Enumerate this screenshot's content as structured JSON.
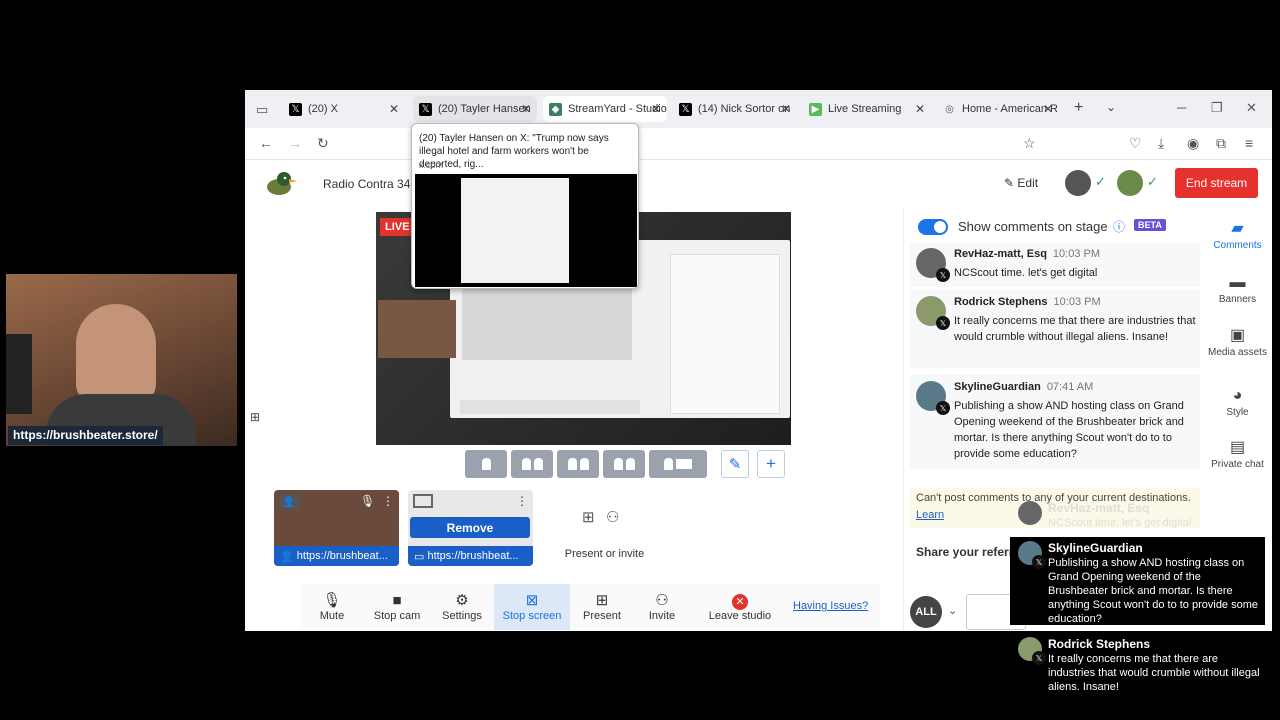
{
  "browser": {
    "tabs": [
      {
        "title": "(20) X",
        "icon": "x-logo-icon"
      },
      {
        "title": "(20) Tayler Hansen",
        "icon": "x-logo-icon"
      },
      {
        "title": "StreamYard - Studio",
        "icon": "streamyard-icon"
      },
      {
        "title": "(14) Nick Sortor on",
        "icon": "x-logo-icon"
      },
      {
        "title": "Live Streaming",
        "icon": "play-icon"
      },
      {
        "title": "Home - American R",
        "icon": "globe-icon"
      }
    ],
    "tab_preview": {
      "title": "(20) Tayler Hansen on X: \"Trump now says illegal hotel and farm workers won't be deported, rig...",
      "domain": "x.com"
    }
  },
  "studio": {
    "broadcast_name": "Radio Contra 34",
    "edit_label": "Edit",
    "end_stream_label": "End stream",
    "live_badge": "LIVE",
    "cards": [
      {
        "label": "https://brushbeat..."
      },
      {
        "label": "https://brushbeat..."
      }
    ],
    "remove_label": "Remove",
    "present_invite_label": "Present or invite",
    "toolbar": [
      {
        "label": "Mute",
        "icon": "mic-icon"
      },
      {
        "label": "Stop cam",
        "icon": "camera-icon"
      },
      {
        "label": "Settings",
        "icon": "gear-icon"
      },
      {
        "label": "Stop screen",
        "icon": "screen-share-icon"
      },
      {
        "label": "Present",
        "icon": "present-icon"
      },
      {
        "label": "Invite",
        "icon": "invite-icon"
      },
      {
        "label": "Leave studio",
        "icon": "leave-icon"
      }
    ],
    "having_issues": "Having Issues?"
  },
  "comments_panel": {
    "toggle_label": "Show comments on stage",
    "beta_badge": "BETA",
    "comments": [
      {
        "name": "RevHaz-matt, Esq",
        "time": "10:03 PM",
        "text": "NCScout time. let's get digital"
      },
      {
        "name": "Rodrick Stephens",
        "time": "10:03 PM",
        "text": "It really concerns me that there are industries that would crumble without illegal aliens. Insane!"
      },
      {
        "name": "SkylineGuardian",
        "time": "07:41 AM",
        "text": "Publishing a show AND hosting class on Grand Opening weekend of the Brushbeater brick and mortar. Is there anything Scout won't do to to provide some education?"
      }
    ],
    "notice": "Can't post comments to any of your current destinations.",
    "learn_more": "Learn",
    "share_label": "Share your referra",
    "all_label": "ALL"
  },
  "side_nav": [
    {
      "label": "Comments",
      "icon": "comment-icon"
    },
    {
      "label": "Banners",
      "icon": "banner-icon"
    },
    {
      "label": "Media assets",
      "icon": "media-icon"
    },
    {
      "label": "Style",
      "icon": "palette-icon"
    },
    {
      "label": "Private chat",
      "icon": "chat-icon"
    }
  ],
  "overlay": {
    "webcam_url": "https://brushbeater.store/",
    "stream_comments": [
      {
        "name": "RevHaz-matt, Esq",
        "text": "NCScout time. let's get digital"
      },
      {
        "name": "SkylineGuardian",
        "text": "Publishing a show AND hosting class on Grand Opening weekend of the Brushbeater brick and mortar. Is there anything Scout won't do to to provide some education?"
      },
      {
        "name": "Rodrick Stephens",
        "text": "It really concerns me that there are industries that would crumble without illegal aliens. Insane!"
      }
    ]
  },
  "colors": {
    "accent": "#1a73e8",
    "end_stream": "#e5322d",
    "live": "#e5322d",
    "card_label": "#1a5fc7"
  }
}
